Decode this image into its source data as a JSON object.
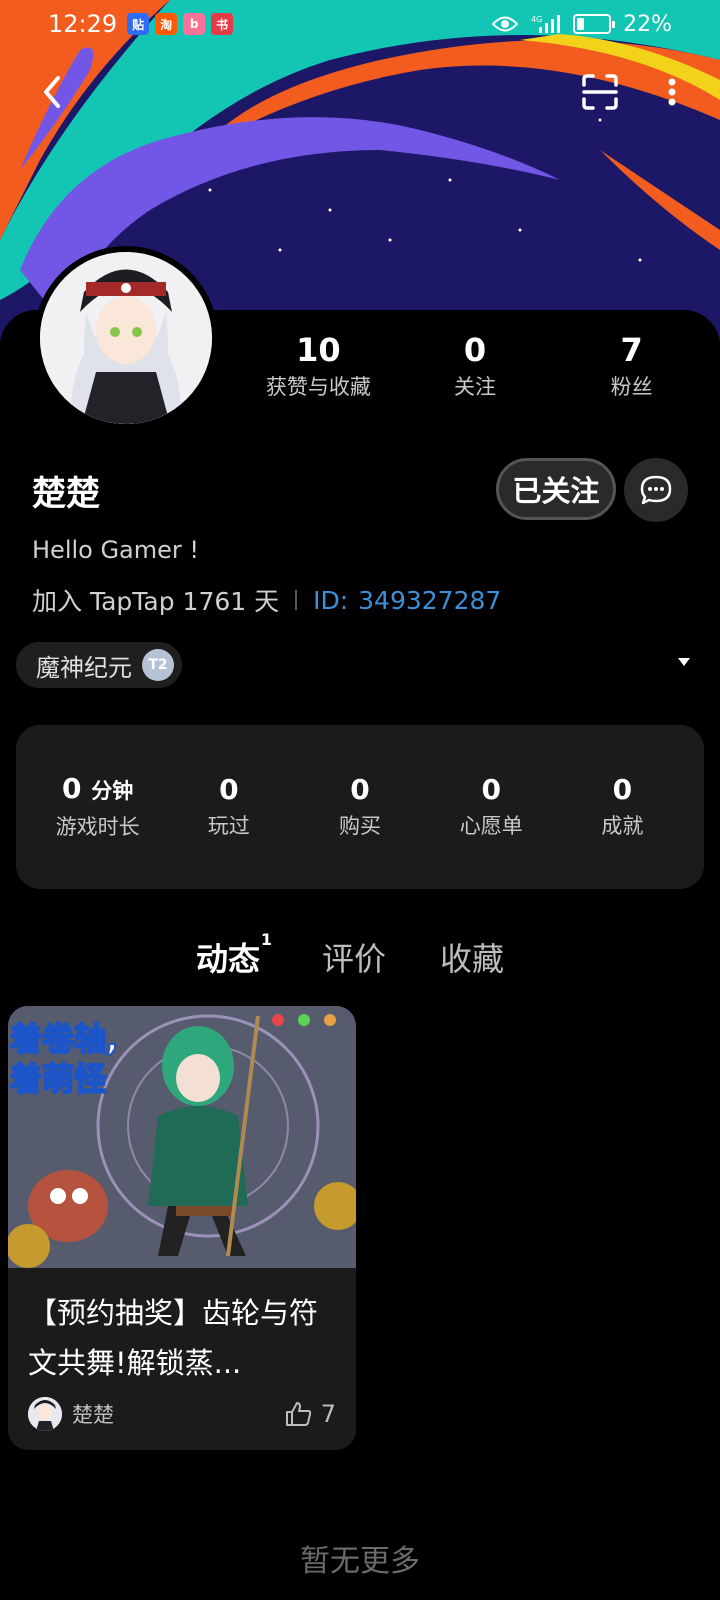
{
  "status_bar": {
    "time": "12:29",
    "apps": [
      {
        "icon": "tieba-icon",
        "glyph": "贴",
        "color": "#2f6cf6"
      },
      {
        "icon": "taobao-icon",
        "glyph": "淘",
        "color": "#ff5a00"
      },
      {
        "icon": "bilibili-icon",
        "glyph": "b",
        "color": "#fb7299"
      },
      {
        "icon": "xiaohongshu-icon",
        "glyph": "书",
        "color": "#e63a46"
      }
    ],
    "battery": "22%",
    "battery_level": 0.22
  },
  "profile": {
    "name": "楚楚",
    "bio": "Hello Gamer !",
    "joined": "加入 TapTap 1761 天",
    "id_label": "ID:",
    "id_value": "349327287",
    "follow_label": "已关注"
  },
  "stats": [
    {
      "value": "10",
      "label": "获赞与收藏"
    },
    {
      "value": "0",
      "label": "关注"
    },
    {
      "value": "7",
      "label": "粉丝"
    }
  ],
  "game_tag": {
    "name": "魔神纪元",
    "badge": "T2"
  },
  "game_stats": {
    "playtime_value": "0",
    "playtime_unit": "分钟",
    "playtime_label": "游戏时长",
    "items": [
      {
        "value": "0",
        "label": "玩过"
      },
      {
        "value": "0",
        "label": "购买"
      },
      {
        "value": "0",
        "label": "心愿单"
      },
      {
        "value": "0",
        "label": "成就"
      }
    ]
  },
  "tabs": [
    {
      "label": "动态",
      "count": "1",
      "active": true
    },
    {
      "label": "评价"
    },
    {
      "label": "收藏"
    }
  ],
  "post": {
    "image_text": "着卷轴,着萌怪",
    "title": "【预约抽奖】齿轮与符文共舞!解锁蒸...",
    "author": "楚楚",
    "likes": "7"
  },
  "end_text": "暂无更多",
  "colors": {
    "accent": "#19c0b8",
    "link": "#3d8fd6",
    "banner_bg": "#1c1766",
    "banner_teal": "#13c6b3",
    "banner_orange": "#f25c1f",
    "banner_purple": "#7257e6",
    "banner_yellow": "#f3d21a"
  }
}
